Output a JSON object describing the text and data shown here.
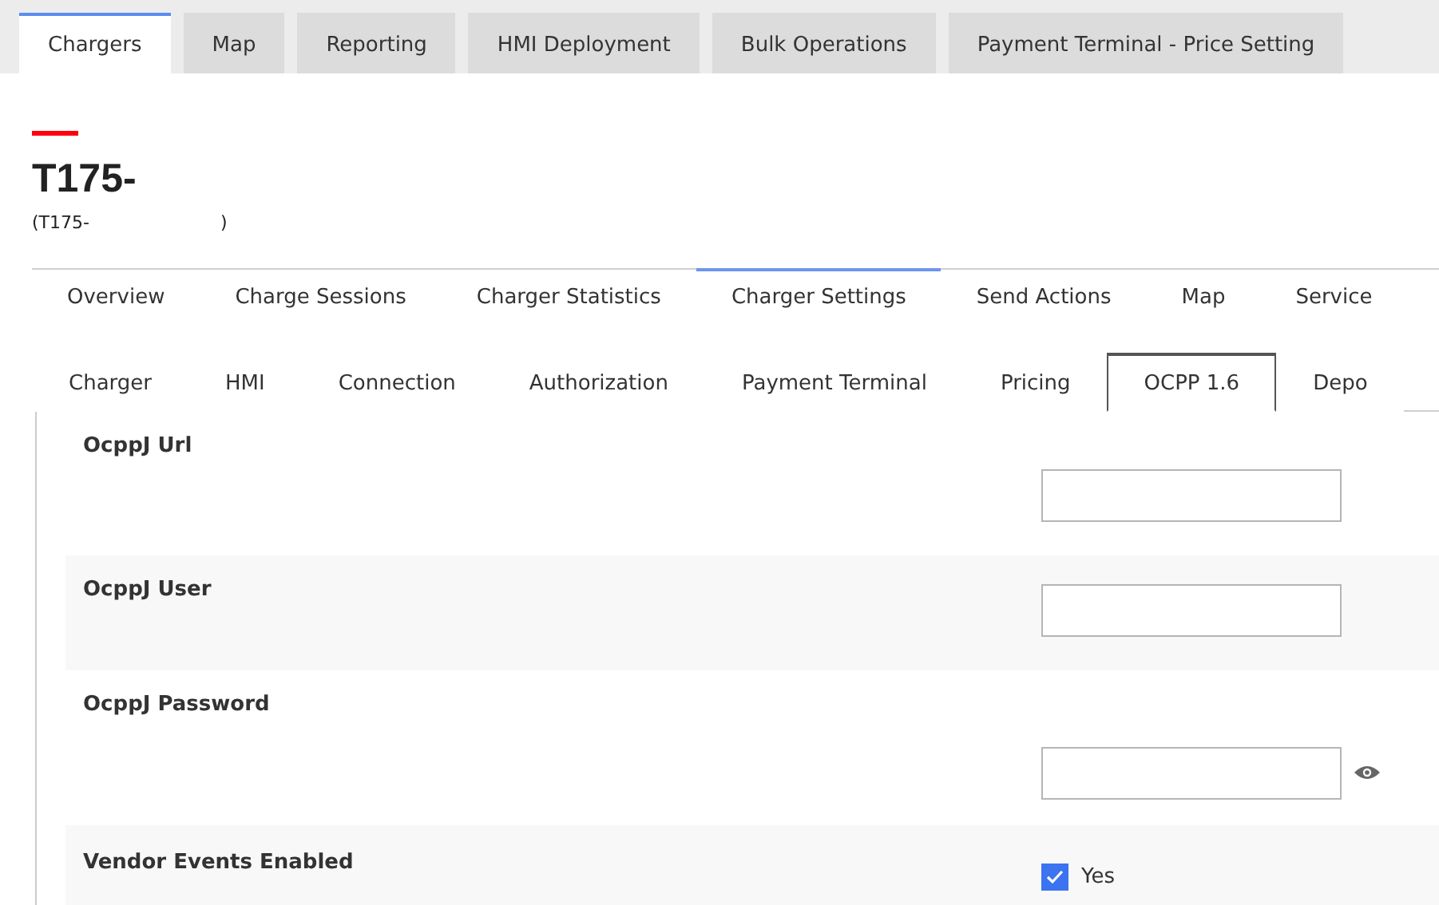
{
  "top_tabs": [
    {
      "label": "Chargers",
      "selected": true
    },
    {
      "label": "Map",
      "selected": false
    },
    {
      "label": "Reporting",
      "selected": false
    },
    {
      "label": "HMI Deployment",
      "selected": false
    },
    {
      "label": "Bulk Operations",
      "selected": false
    },
    {
      "label": "Payment Terminal - Price Setting",
      "selected": false
    }
  ],
  "charger": {
    "title": "T175-",
    "subtitle_start": "(T175-",
    "subtitle_end": ")"
  },
  "section_tabs": [
    {
      "label": "Overview",
      "selected": false
    },
    {
      "label": "Charge Sessions",
      "selected": false
    },
    {
      "label": "Charger Statistics",
      "selected": false
    },
    {
      "label": "Charger Settings",
      "selected": true
    },
    {
      "label": "Send Actions",
      "selected": false
    },
    {
      "label": "Map",
      "selected": false
    },
    {
      "label": "Service",
      "selected": false
    }
  ],
  "settings_tabs": [
    {
      "label": "Charger",
      "selected": false
    },
    {
      "label": "HMI",
      "selected": false
    },
    {
      "label": "Connection",
      "selected": false
    },
    {
      "label": "Authorization",
      "selected": false
    },
    {
      "label": "Payment Terminal",
      "selected": false
    },
    {
      "label": "Pricing",
      "selected": false
    },
    {
      "label": "OCPP 1.6",
      "selected": true
    },
    {
      "label": "Depo",
      "selected": false
    }
  ],
  "fields": [
    {
      "kind": "text",
      "label": "OcppJ Url"
    },
    {
      "kind": "text",
      "label": "OcppJ User"
    },
    {
      "kind": "password",
      "label": "OcppJ Password"
    },
    {
      "kind": "checkbox",
      "label": "Vendor Events Enabled",
      "checked": true,
      "option": "Yes"
    }
  ]
}
